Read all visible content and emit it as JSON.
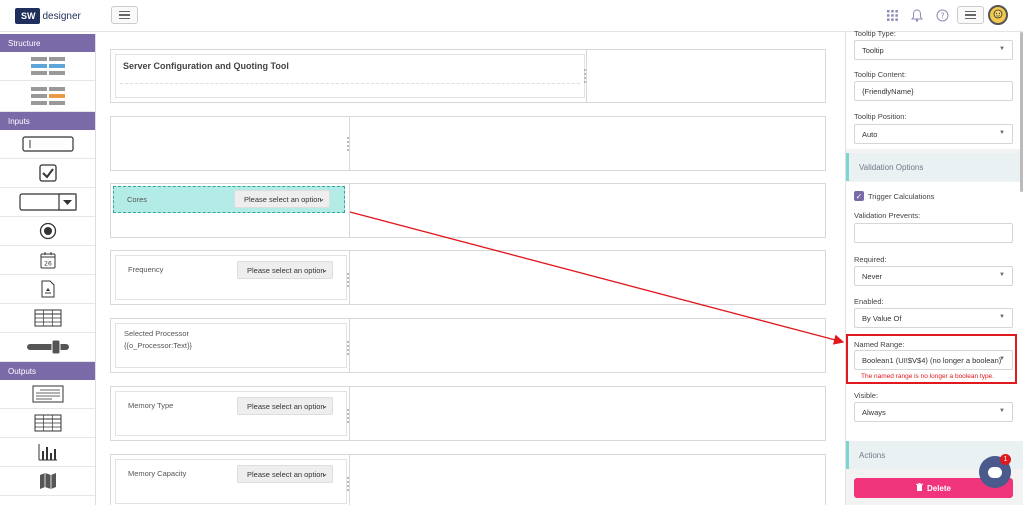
{
  "app": {
    "logo_badge": "SW",
    "logo_text": "designer"
  },
  "topbar": {
    "grid_icon": "grid-icon",
    "bell_icon": "bell-icon",
    "help_icon": "help-icon",
    "menu_icon": "menu-icon",
    "avatar": "avatar-icon"
  },
  "palette": {
    "structure_label": "Structure",
    "inputs_label": "Inputs",
    "outputs_label": "Outputs"
  },
  "canvas": {
    "title": "Server Configuration and Quoting Tool",
    "rows": [
      {
        "label": "Cores",
        "placeholder": "Please select an option"
      },
      {
        "label": "Frequency",
        "placeholder": "Please select an option"
      },
      {
        "label": "Selected Processor",
        "value": "{{o_Processor:Text}}"
      },
      {
        "label": "Memory Type",
        "placeholder": "Please select an option"
      },
      {
        "label": "Memory Capacity",
        "placeholder": "Please select an option"
      }
    ]
  },
  "panel": {
    "tooltip_type_label": "Tooltip Type:",
    "tooltip_type_value": "Tooltip",
    "tooltip_content_label": "Tooltip Content:",
    "tooltip_content_value": "{FriendlyName}",
    "tooltip_position_label": "Tooltip Position:",
    "tooltip_position_value": "Auto",
    "validation_section": "Validation Options",
    "trigger_calculations": "Trigger Calculations",
    "validation_prevents_label": "Validation Prevents:",
    "required_label": "Required:",
    "required_value": "Never",
    "enabled_label": "Enabled:",
    "enabled_value": "By Value Of",
    "named_range_label": "Named Range:",
    "named_range_value": "Boolean1 (UI!$V$4) (no longer a boolean)",
    "named_range_error": "The named range is no longer a boolean type.",
    "visible_label": "Visible:",
    "visible_value": "Always",
    "actions_section": "Actions",
    "delete_label": "Delete"
  },
  "chat": {
    "badge": "1"
  },
  "colors": {
    "accent_purple": "#7b6aa8",
    "teal_selected": "#b3ece6",
    "error_red": "#e0191e",
    "delete_pink": "#f0357c"
  }
}
